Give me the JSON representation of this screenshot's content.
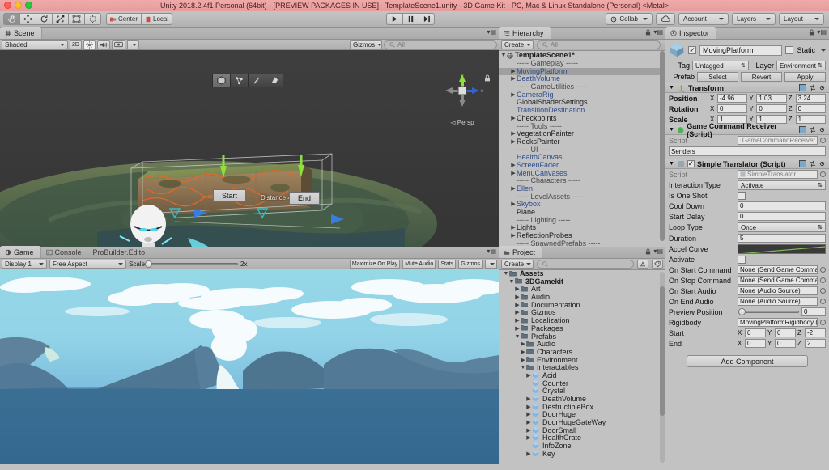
{
  "window": {
    "title": "Unity 2018.2.4f1 Personal (64bit) - [PREVIEW PACKAGES IN USE] - TemplateScene1.unity - 3D Game Kit - PC, Mac & Linux Standalone (Personal) <Metal>"
  },
  "toolbar": {
    "transform_tools": [
      "hand-tool",
      "move-tool",
      "rotate-tool",
      "scale-tool",
      "rect-tool",
      "transform-tool"
    ],
    "pivot_mode": "Center",
    "pivot_rotation": "Local",
    "play": "play-icon",
    "pause": "pause-icon",
    "step": "step-icon",
    "collab": "Collab",
    "cloud": "cloud-icon",
    "account": "Account",
    "layers": "Layers",
    "layout": "Layout"
  },
  "scene": {
    "tab": "Scene",
    "shading_mode": "Shaded",
    "mode_2d": "2D",
    "toggles": [
      "lighting-icon",
      "audio-icon",
      "fx-icon"
    ],
    "gizmos": "Gizmos",
    "search_placeholder": "All",
    "probuilder_tools": [
      "object-mode-icon",
      "vertex-mode-icon",
      "edge-mode-icon",
      "face-mode-icon"
    ],
    "compass": {
      "x": "x",
      "y": "y",
      "z": "z",
      "projection": "Persp"
    },
    "labels": {
      "start": "Start",
      "end": "End",
      "distance": "Distance 4"
    }
  },
  "game": {
    "tabs": [
      {
        "label": "Game",
        "active": true
      },
      {
        "label": "Console",
        "active": false
      },
      {
        "label": "ProBuilder.Edito",
        "active": false
      }
    ],
    "display": "Display 1",
    "aspect": "Free Aspect",
    "scale_label": "Scale",
    "scale_value": "2x",
    "maximize_on_play": "Maximize On Play",
    "mute_audio": "Mute Audio",
    "stats": "Stats",
    "gizmos": "Gizmos"
  },
  "hierarchy": {
    "tab": "Hierarchy",
    "create": "Create",
    "search_placeholder": "All",
    "scene_name": "TemplateScene1*",
    "items": [
      {
        "label": "----- Gameplay -----",
        "indent": 1,
        "arrow": false,
        "style": "sep",
        "selected": false
      },
      {
        "label": "MovingPlatform",
        "indent": 1,
        "arrow": true,
        "style": "blue",
        "selected": true
      },
      {
        "label": "DeathVolume",
        "indent": 1,
        "arrow": true,
        "style": "blue",
        "selected": false
      },
      {
        "label": "----- GameUtilities -----",
        "indent": 1,
        "arrow": false,
        "style": "sep",
        "selected": false
      },
      {
        "label": "CameraRig",
        "indent": 1,
        "arrow": true,
        "style": "blue",
        "selected": false
      },
      {
        "label": "GlobalShaderSettings",
        "indent": 1,
        "arrow": false,
        "style": "plain",
        "selected": false
      },
      {
        "label": "TransitionDestination",
        "indent": 1,
        "arrow": false,
        "style": "blue",
        "selected": false
      },
      {
        "label": "Checkpoints",
        "indent": 1,
        "arrow": true,
        "style": "plain",
        "selected": false
      },
      {
        "label": "----- Tools -----",
        "indent": 1,
        "arrow": false,
        "style": "sep",
        "selected": false
      },
      {
        "label": "VegetationPainter",
        "indent": 1,
        "arrow": true,
        "style": "plain",
        "selected": false
      },
      {
        "label": "RocksPainter",
        "indent": 1,
        "arrow": true,
        "style": "plain",
        "selected": false
      },
      {
        "label": "----- UI -----",
        "indent": 1,
        "arrow": false,
        "style": "sep",
        "selected": false
      },
      {
        "label": "HealthCanvas",
        "indent": 1,
        "arrow": false,
        "style": "blue",
        "selected": false
      },
      {
        "label": "ScreenFader",
        "indent": 1,
        "arrow": true,
        "style": "blue",
        "selected": false
      },
      {
        "label": "MenuCanvases",
        "indent": 1,
        "arrow": true,
        "style": "blue",
        "selected": false
      },
      {
        "label": "----- Characters -----",
        "indent": 1,
        "arrow": false,
        "style": "sep",
        "selected": false
      },
      {
        "label": "Ellen",
        "indent": 1,
        "arrow": true,
        "style": "blue",
        "selected": false
      },
      {
        "label": "----- LevelAssets -----",
        "indent": 1,
        "arrow": false,
        "style": "sep",
        "selected": false
      },
      {
        "label": "Skybox",
        "indent": 1,
        "arrow": true,
        "style": "blue",
        "selected": false
      },
      {
        "label": "Plane",
        "indent": 1,
        "arrow": false,
        "style": "plain",
        "selected": false
      },
      {
        "label": "----- Lighting -----",
        "indent": 1,
        "arrow": false,
        "style": "sep",
        "selected": false
      },
      {
        "label": "Lights",
        "indent": 1,
        "arrow": true,
        "style": "plain",
        "selected": false
      },
      {
        "label": "ReflectionProbes",
        "indent": 1,
        "arrow": true,
        "style": "plain",
        "selected": false
      },
      {
        "label": "----- SpawnedPrefabs -----",
        "indent": 1,
        "arrow": false,
        "style": "sep",
        "selected": false
      }
    ]
  },
  "project": {
    "tab": "Project",
    "create": "Create",
    "search_placeholder": "",
    "items": [
      {
        "label": "Assets",
        "indent": 0,
        "arrow": "open",
        "icon": "folder",
        "bold": true
      },
      {
        "label": "3DGamekit",
        "indent": 1,
        "arrow": "open",
        "icon": "folder",
        "bold": true
      },
      {
        "label": "Art",
        "indent": 2,
        "arrow": "closed",
        "icon": "folder",
        "bold": false
      },
      {
        "label": "Audio",
        "indent": 2,
        "arrow": "closed",
        "icon": "folder",
        "bold": false
      },
      {
        "label": "Documentation",
        "indent": 2,
        "arrow": "closed",
        "icon": "folder",
        "bold": false
      },
      {
        "label": "Gizmos",
        "indent": 2,
        "arrow": "closed",
        "icon": "folder",
        "bold": false
      },
      {
        "label": "Localization",
        "indent": 2,
        "arrow": "closed",
        "icon": "folder",
        "bold": false
      },
      {
        "label": "Packages",
        "indent": 2,
        "arrow": "closed",
        "icon": "folder",
        "bold": false
      },
      {
        "label": "Prefabs",
        "indent": 2,
        "arrow": "open",
        "icon": "folder",
        "bold": false
      },
      {
        "label": "Audio",
        "indent": 3,
        "arrow": "closed",
        "icon": "folder",
        "bold": false
      },
      {
        "label": "Characters",
        "indent": 3,
        "arrow": "closed",
        "icon": "folder",
        "bold": false
      },
      {
        "label": "Environment",
        "indent": 3,
        "arrow": "closed",
        "icon": "folder",
        "bold": false
      },
      {
        "label": "Interactables",
        "indent": 3,
        "arrow": "open",
        "icon": "folder",
        "bold": false
      },
      {
        "label": "Acid",
        "indent": 4,
        "arrow": "closed",
        "icon": "prefab",
        "bold": false
      },
      {
        "label": "Counter",
        "indent": 4,
        "arrow": "none",
        "icon": "prefab",
        "bold": false
      },
      {
        "label": "Crystal",
        "indent": 4,
        "arrow": "none",
        "icon": "prefab",
        "bold": false
      },
      {
        "label": "DeathVolume",
        "indent": 4,
        "arrow": "closed",
        "icon": "prefab",
        "bold": false
      },
      {
        "label": "DestructibleBox",
        "indent": 4,
        "arrow": "closed",
        "icon": "prefab",
        "bold": false
      },
      {
        "label": "DoorHuge",
        "indent": 4,
        "arrow": "closed",
        "icon": "prefab",
        "bold": false
      },
      {
        "label": "DoorHugeGateWay",
        "indent": 4,
        "arrow": "closed",
        "icon": "prefab",
        "bold": false
      },
      {
        "label": "DoorSmall",
        "indent": 4,
        "arrow": "closed",
        "icon": "prefab",
        "bold": false
      },
      {
        "label": "HealthCrate",
        "indent": 4,
        "arrow": "closed",
        "icon": "prefab",
        "bold": false
      },
      {
        "label": "InfoZone",
        "indent": 4,
        "arrow": "none",
        "icon": "prefab",
        "bold": false
      },
      {
        "label": "Key",
        "indent": 4,
        "arrow": "closed",
        "icon": "prefab",
        "bold": false
      }
    ]
  },
  "inspector": {
    "tab": "Inspector",
    "object_name": "MovingPlatform",
    "object_enabled": true,
    "static_label": "Static",
    "static_checked": false,
    "tag_label": "Tag",
    "tag_value": "Untagged",
    "layer_label": "Layer",
    "layer_value": "Environment",
    "prefab_label": "Prefab",
    "prefab_buttons": [
      "Select",
      "Revert",
      "Apply"
    ],
    "transform": {
      "title": "Transform",
      "rows": [
        {
          "name": "Position",
          "x": "-4.96",
          "y": "1.03",
          "z": "3.24"
        },
        {
          "name": "Rotation",
          "x": "0",
          "y": "0",
          "z": "0"
        },
        {
          "name": "Scale",
          "x": "1",
          "y": "1",
          "z": "1"
        }
      ]
    },
    "game_command_receiver": {
      "title": "Game Command Receiver (Script)",
      "script_label": "Script",
      "script_value": "GameCommandReceiver",
      "senders_label": "Senders"
    },
    "simple_translator": {
      "title": "Simple Translator (Script)",
      "enabled": true,
      "script_label": "Script",
      "script_value": "SimpleTranslator",
      "props": [
        {
          "name": "Interaction Type",
          "type": "dropdown",
          "value": "Activate"
        },
        {
          "name": "Is One Shot",
          "type": "checkbox",
          "value": false
        },
        {
          "name": "Cool Down",
          "type": "text",
          "value": "0"
        },
        {
          "name": "Start Delay",
          "type": "text",
          "value": "0"
        },
        {
          "name": "Loop Type",
          "type": "dropdown",
          "value": "Once"
        },
        {
          "name": "Duration",
          "type": "text",
          "value": "5"
        },
        {
          "name": "Accel Curve",
          "type": "curve",
          "value": ""
        },
        {
          "name": "Activate",
          "type": "checkbox",
          "value": false
        },
        {
          "name": "On Start Command",
          "type": "object",
          "value": "None (Send Game Command)"
        },
        {
          "name": "On Stop Command",
          "type": "object",
          "value": "None (Send Game Command)"
        },
        {
          "name": "On Start Audio",
          "type": "object",
          "value": "None (Audio Source)"
        },
        {
          "name": "On End Audio",
          "type": "object",
          "value": "None (Audio Source)"
        },
        {
          "name": "Preview Position",
          "type": "slider",
          "value": "0"
        },
        {
          "name": "Rigidbody",
          "type": "object",
          "value": "MovingPlatformRigidbody (Rig"
        }
      ],
      "vectors": [
        {
          "name": "Start",
          "x": "0",
          "y": "0",
          "z": "-2"
        },
        {
          "name": "End",
          "x": "0",
          "y": "0",
          "z": "2"
        }
      ]
    },
    "add_component": "Add Component"
  },
  "colors": {
    "chrome": "#c2c2c2",
    "titlebar": "#efa8a8",
    "selection": "#a0a0a0",
    "prefab_blue": "#2e4c8c",
    "scene_bg": "#3b3b3b",
    "sky": "#8fd4e4",
    "water": "#3a6e96"
  }
}
